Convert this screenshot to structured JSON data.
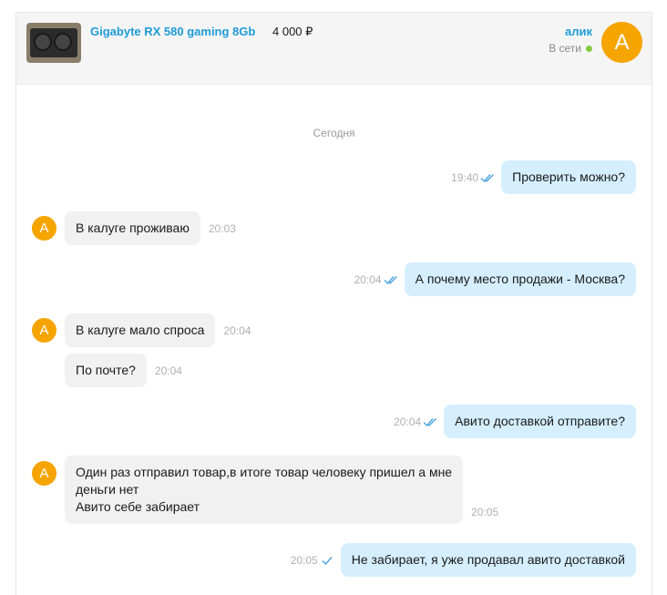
{
  "header": {
    "product_title": "Gigabyte RX 580 gaming 8Gb",
    "price": "4 000 ₽",
    "user_name": "алик",
    "user_status": "В сети",
    "avatar_letter": "А",
    "status_color": "#85c940",
    "accent_color": "#1e9bd7"
  },
  "chat": {
    "day_separator": "Сегодня",
    "messages": [
      {
        "dir": "out",
        "text": "Проверить можно?",
        "time": "19:40",
        "check": "double-check-icon"
      },
      {
        "dir": "in",
        "text": "В калуге проживаю",
        "time": "20:03",
        "avatar": "А"
      },
      {
        "dir": "out",
        "text": "А почему место продажи - Москва?",
        "time": "20:04",
        "check": "double-check-icon"
      },
      {
        "dir": "in",
        "text": "В калуге мало спроса",
        "time": "20:04",
        "avatar": "А"
      },
      {
        "dir": "in",
        "text": "По почте?",
        "time": "20:04",
        "avatar": "А"
      },
      {
        "dir": "out",
        "text": "Авито доставкой отправите?",
        "time": "20:04",
        "check": "double-check-icon"
      },
      {
        "dir": "in",
        "text": "Один раз отправил товар,в итоге товар человеку пришел а мне\nденьги нет\nАвито себе забирает",
        "time": "20:05",
        "avatar": "А"
      },
      {
        "dir": "out",
        "text": "Не забирает, я уже продавал авито доставкой",
        "time": "20:05",
        "check": "single-check-icon"
      }
    ]
  }
}
